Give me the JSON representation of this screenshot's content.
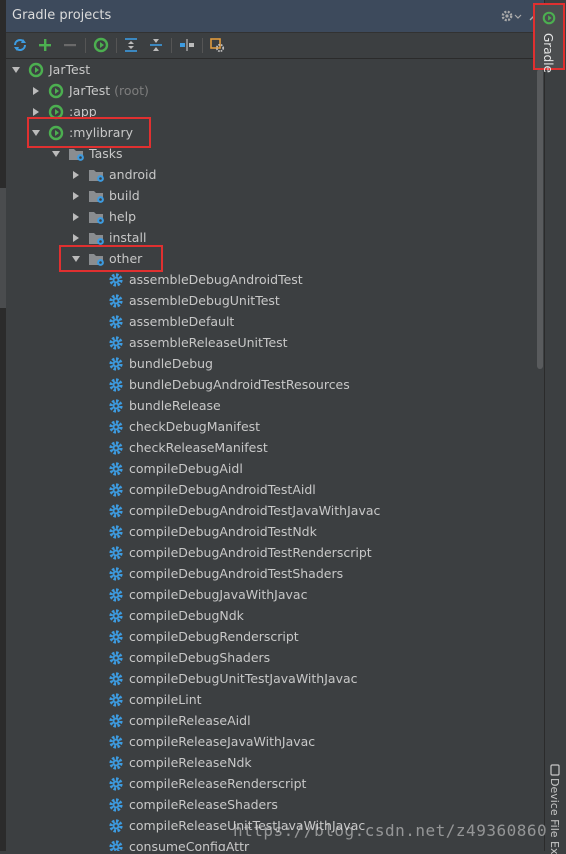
{
  "panel": {
    "title": "Gradle projects"
  },
  "side_tabs": {
    "gradle": "Gradle",
    "device_file_explorer": "Device File Ex"
  },
  "watermark": "https://blog.csdn.net/z49360860",
  "colors": {
    "highlight_box": "#e03030",
    "gear_blue": "#3d9be0",
    "gradle_green": "#4caf50"
  },
  "toolbar": {
    "icons": [
      "refresh-icon",
      "add-icon",
      "remove-icon",
      "execute-task-icon",
      "expand-all-icon",
      "collapse-all-icon",
      "link-icon",
      "settings-icon"
    ]
  },
  "tree": {
    "root": "JarTest",
    "projects": [
      {
        "name": "JarTest",
        "suffix": "(root)"
      },
      {
        "name": ":app",
        "suffix": ""
      },
      {
        "name": ":mylibrary",
        "suffix": ""
      }
    ],
    "tasks_folder": "Tasks",
    "task_groups": [
      "android",
      "build",
      "help",
      "install",
      "other"
    ],
    "other_tasks": [
      "assembleDebugAndroidTest",
      "assembleDebugUnitTest",
      "assembleDefault",
      "assembleReleaseUnitTest",
      "bundleDebug",
      "bundleDebugAndroidTestResources",
      "bundleRelease",
      "checkDebugManifest",
      "checkReleaseManifest",
      "compileDebugAidl",
      "compileDebugAndroidTestAidl",
      "compileDebugAndroidTestJavaWithJavac",
      "compileDebugAndroidTestNdk",
      "compileDebugAndroidTestRenderscript",
      "compileDebugAndroidTestShaders",
      "compileDebugJavaWithJavac",
      "compileDebugNdk",
      "compileDebugRenderscript",
      "compileDebugShaders",
      "compileDebugUnitTestJavaWithJavac",
      "compileLint",
      "compileReleaseAidl",
      "compileReleaseJavaWithJavac",
      "compileReleaseNdk",
      "compileReleaseRenderscript",
      "compileReleaseShaders",
      "compileReleaseUnitTestJavaWithJavac",
      "consumeConfigAttr"
    ]
  }
}
